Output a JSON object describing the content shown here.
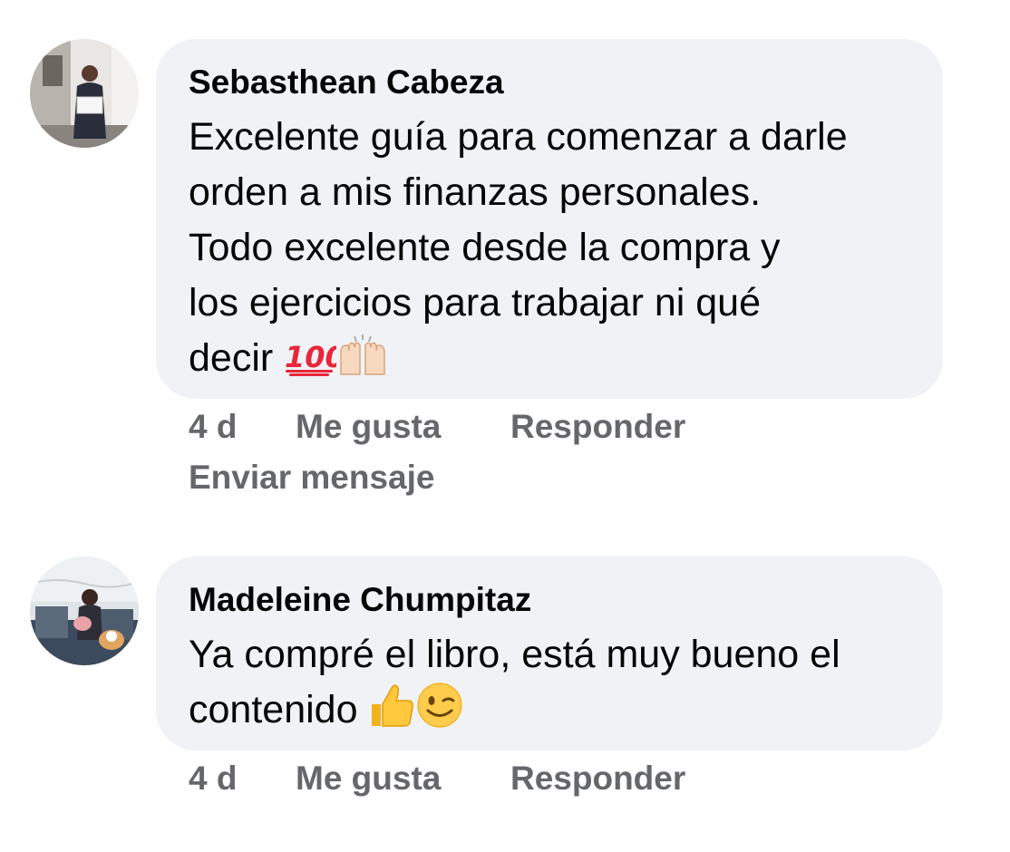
{
  "comments": [
    {
      "author": "Sebasthean Cabeza",
      "text": "Excelente guía para comenzar a darle\norden a mis finanzas personales.\nTodo excelente desde la compra y\nlos ejercicios para trabajar ni qué\ndecir ",
      "emojis": [
        "hundred-points-emoji",
        "raising-hands-emoji"
      ],
      "time": "4 d",
      "like_label": "Me gusta",
      "reply_label": "Responder",
      "send_label": "Enviar mensaje"
    },
    {
      "author": "Madeleine Chumpitaz",
      "text": "Ya compré el libro, está muy bueno el\ncontenido ",
      "emojis": [
        "thumbs-up-emoji",
        "winking-face-emoji"
      ],
      "time": "4 d",
      "like_label": "Me gusta",
      "reply_label": "Responder"
    }
  ],
  "colors": {
    "bubble_bg": "#f0f2f5",
    "action_text": "#65676b",
    "body_text": "#050505"
  }
}
